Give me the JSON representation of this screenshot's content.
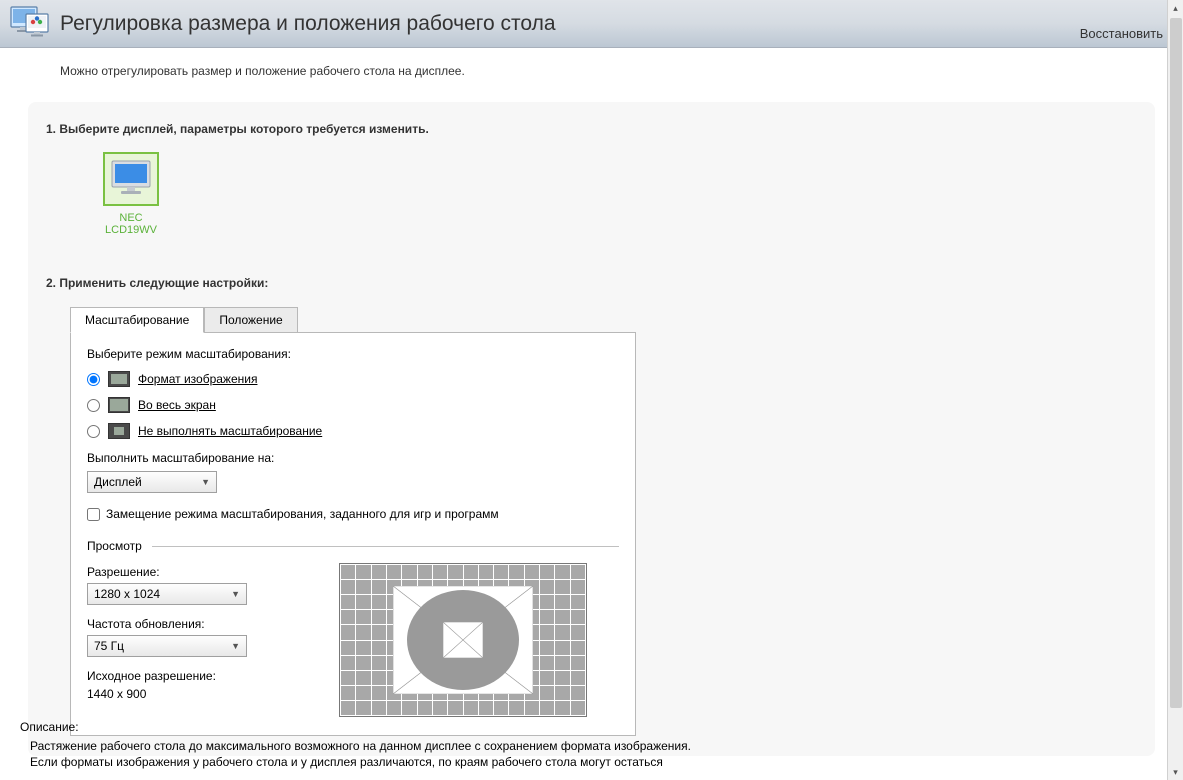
{
  "header": {
    "title": "Регулировка размера и положения рабочего стола",
    "restore": "Восстановить"
  },
  "intro": "Можно отрегулировать размер и положение рабочего стола на дисплее.",
  "step1": {
    "heading": "1. Выберите дисплей, параметры которого требуется изменить.",
    "display_name": "NEC LCD19WV"
  },
  "step2": {
    "heading": "2. Применить следующие настройки:"
  },
  "tabs": {
    "scaling": "Масштабирование",
    "position": "Положение"
  },
  "scaling": {
    "mode_label": "Выберите режим масштабирования:",
    "options": {
      "aspect": "Формат изображения",
      "fullscreen": "Во весь экран",
      "none": "Не выполнять масштабирование"
    },
    "selected": "aspect",
    "perform_on_label": "Выполнить масштабирование на:",
    "perform_on_value": "Дисплей",
    "override_label": "Замещение режима масштабирования, заданного для игр и программ"
  },
  "preview": {
    "section_label": "Просмотр",
    "resolution_label": "Разрешение:",
    "resolution_value": "1280 x 1024",
    "refresh_label": "Частота обновления:",
    "refresh_value": "75 Гц",
    "native_label": "Исходное разрешение:",
    "native_value": "1440 x 900"
  },
  "description": {
    "heading": "Описание:",
    "body": "Растяжение рабочего стола до максимального возможного на данном дисплее с сохранением формата изображения.\nЕсли форматы изображения у рабочего стола и у дисплея различаются, по краям рабочего стола могут остаться"
  }
}
